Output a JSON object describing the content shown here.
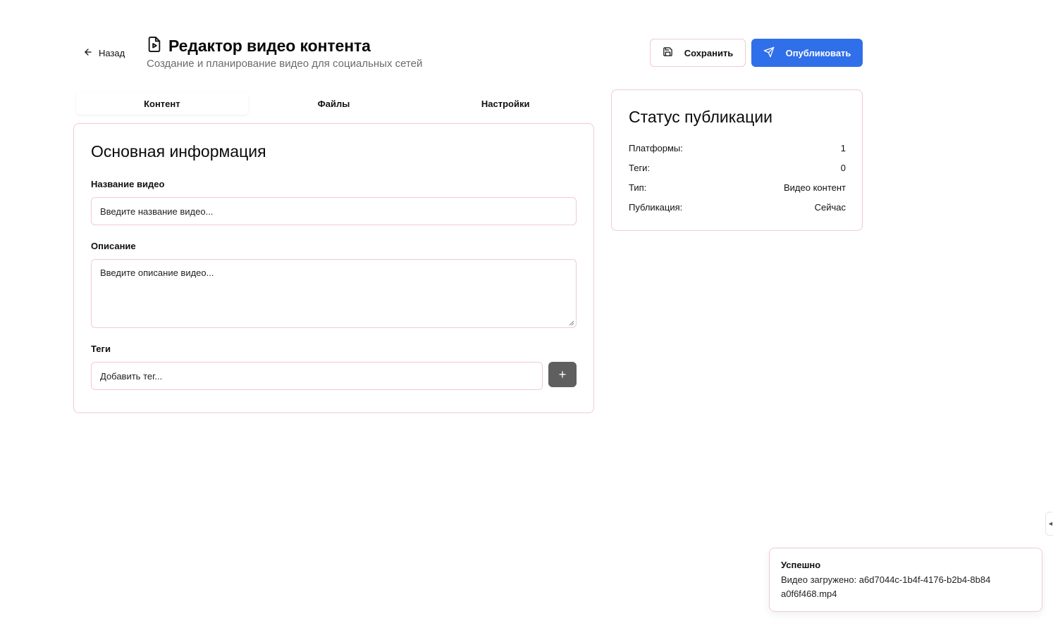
{
  "header": {
    "back_label": "Назад",
    "title": "Редактор видео контента",
    "subtitle": "Создание и планирование видео для социальных сетей",
    "save_label": "Сохранить",
    "publish_label": "Опубликовать",
    "accent_color": "#2f6fea",
    "border_color": "#f3c9d4"
  },
  "tabs": [
    {
      "label": "Контент",
      "active": true
    },
    {
      "label": "Файлы",
      "active": false
    },
    {
      "label": "Настройки",
      "active": false
    }
  ],
  "main": {
    "title": "Основная информация",
    "video_name": {
      "label": "Название видео",
      "placeholder": "Введите название видео..."
    },
    "description": {
      "label": "Описание",
      "placeholder": "Введите описание видео..."
    },
    "tags": {
      "label": "Теги",
      "placeholder": "Добавить тег...",
      "add_icon": "+"
    }
  },
  "status": {
    "title": "Статус публикации",
    "rows": [
      {
        "label": "Платформы:",
        "value": "1"
      },
      {
        "label": "Теги:",
        "value": "0"
      },
      {
        "label": "Тип:",
        "value": "Видео контент"
      },
      {
        "label": "Публикация:",
        "value": "Сейчас"
      }
    ]
  },
  "toast": {
    "title": "Успешно",
    "message": "Видео загружено: a6d7044c-1b4f-4176-b2b4-8b84a0f6f468.mp4"
  },
  "side_panel_toggle": "◀"
}
